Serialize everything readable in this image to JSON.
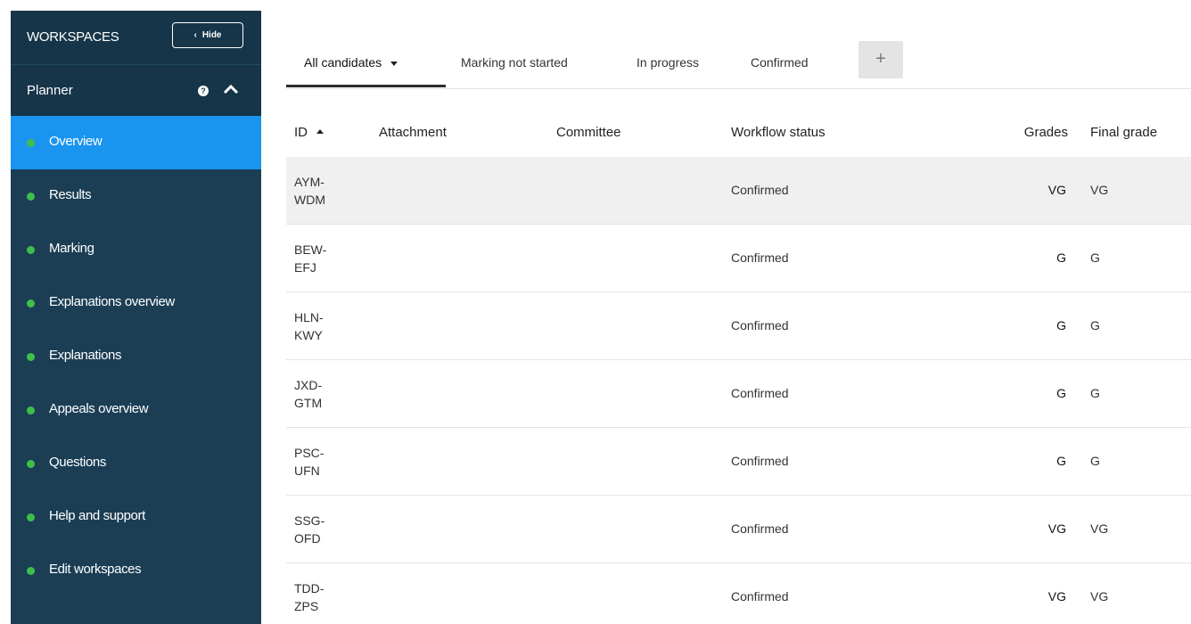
{
  "sidebar": {
    "title": "WORKSPACES",
    "hide_label": "Hide",
    "planner_label": "Planner",
    "items": [
      {
        "label": "Overview",
        "active": true
      },
      {
        "label": "Results"
      },
      {
        "label": "Marking"
      },
      {
        "label": "Explanations overview"
      },
      {
        "label": "Explanations"
      },
      {
        "label": "Appeals overview"
      },
      {
        "label": "Questions"
      },
      {
        "label": "Help and support"
      },
      {
        "label": "Edit workspaces"
      }
    ]
  },
  "tabs": [
    {
      "label": "All candidates",
      "active": true
    },
    {
      "label": "Marking not started"
    },
    {
      "label": "In progress"
    },
    {
      "label": "Confirmed"
    }
  ],
  "add_tab_symbol": "+",
  "table": {
    "headers": {
      "id": "ID",
      "attachment": "Attachment",
      "committee": "Committee",
      "workflow_status": "Workflow status",
      "grades": "Grades",
      "final_grade": "Final grade"
    },
    "rows": [
      {
        "id_line1": "AYM-",
        "id_line2": "WDM",
        "status": "Confirmed",
        "grade": "VG",
        "final": "VG"
      },
      {
        "id_line1": "BEW-",
        "id_line2": "EFJ",
        "status": "Confirmed",
        "grade": "G",
        "final": "G"
      },
      {
        "id_line1": "HLN-",
        "id_line2": "KWY",
        "status": "Confirmed",
        "grade": "G",
        "final": "G"
      },
      {
        "id_line1": "JXD-",
        "id_line2": "GTM",
        "status": "Confirmed",
        "grade": "G",
        "final": "G"
      },
      {
        "id_line1": "PSC-",
        "id_line2": "UFN",
        "status": "Confirmed",
        "grade": "G",
        "final": "G"
      },
      {
        "id_line1": "SSG-",
        "id_line2": "OFD",
        "status": "Confirmed",
        "grade": "VG",
        "final": "VG"
      },
      {
        "id_line1": "TDD-",
        "id_line2": "ZPS",
        "status": "Confirmed",
        "grade": "VG",
        "final": "VG"
      }
    ]
  },
  "colors": {
    "sidebar_bg": "#1b3e55",
    "active_item": "#1a95ef",
    "status_dot": "#3fbf4a"
  }
}
